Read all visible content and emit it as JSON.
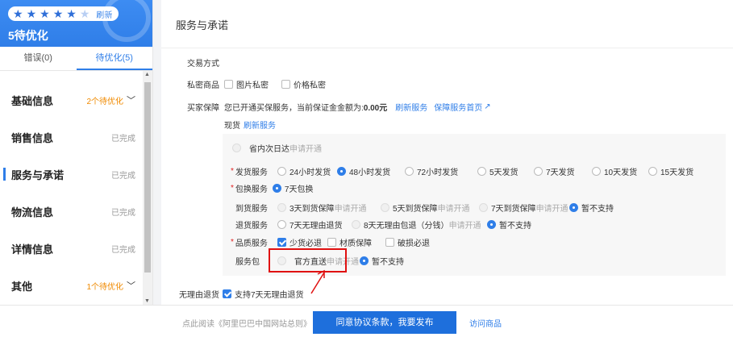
{
  "score": {
    "refresh": "刷新",
    "text": "5待优化",
    "stars": 5
  },
  "tabs": [
    {
      "label": "错误(0)"
    },
    {
      "label": "待优化(5)"
    }
  ],
  "nav": [
    {
      "name": "基础信息",
      "status": "2个待优化"
    },
    {
      "name": "销售信息",
      "status": "已完成"
    },
    {
      "name": "服务与承诺",
      "status": "已完成"
    },
    {
      "name": "物流信息",
      "status": "已完成"
    },
    {
      "name": "详情信息",
      "status": "已完成"
    },
    {
      "name": "其他",
      "status": "1个待优化"
    }
  ],
  "panel": {
    "title": "服务与承诺",
    "trade_mode": "交易方式",
    "private_label": "私密商品",
    "private_opts": [
      "图片私密",
      "价格私密"
    ],
    "guarantee_label": "买家保障",
    "guarantee_text": "您已开通买保服务，当前保证金金额为:",
    "guarantee_amount": "0.00元",
    "refresh_service": "刷新服务",
    "guarantee_home": "保障服务首页",
    "spot_label": "现货",
    "spot_refresh": "刷新服务",
    "next_day": "省内次日达",
    "apply": "申请开通",
    "ship_label": "发货服务",
    "ship_opts": [
      "24小时发货",
      "48小时发货",
      "72小时发货",
      "5天发货",
      "7天发货",
      "10天发货",
      "15天发货"
    ],
    "exchange_label": "包换服务",
    "exchange_opt": "7天包换",
    "arrival_label": "到货服务",
    "arrival_opts": [
      "3天到货保障",
      "5天到货保障",
      "7天到货保障"
    ],
    "not_supported": "暂不支持",
    "return_label": "退货服务",
    "return_opts": [
      "7天无理由退货",
      "8天无理由包退（分钱）"
    ],
    "quality_label": "品质服务",
    "quality_opts": [
      "少货必退",
      "材质保障",
      "破损必退"
    ],
    "pack_label": "服务包",
    "pack_opt": "官方直送",
    "no_reason_label": "无理由退货",
    "no_reason_opt": "支持7天无理由退货"
  },
  "footer": {
    "note": "点此阅读《阿里巴巴中国网站总则》",
    "agree": "同意协议条款，我要发布",
    "visit": "访问商品"
  }
}
